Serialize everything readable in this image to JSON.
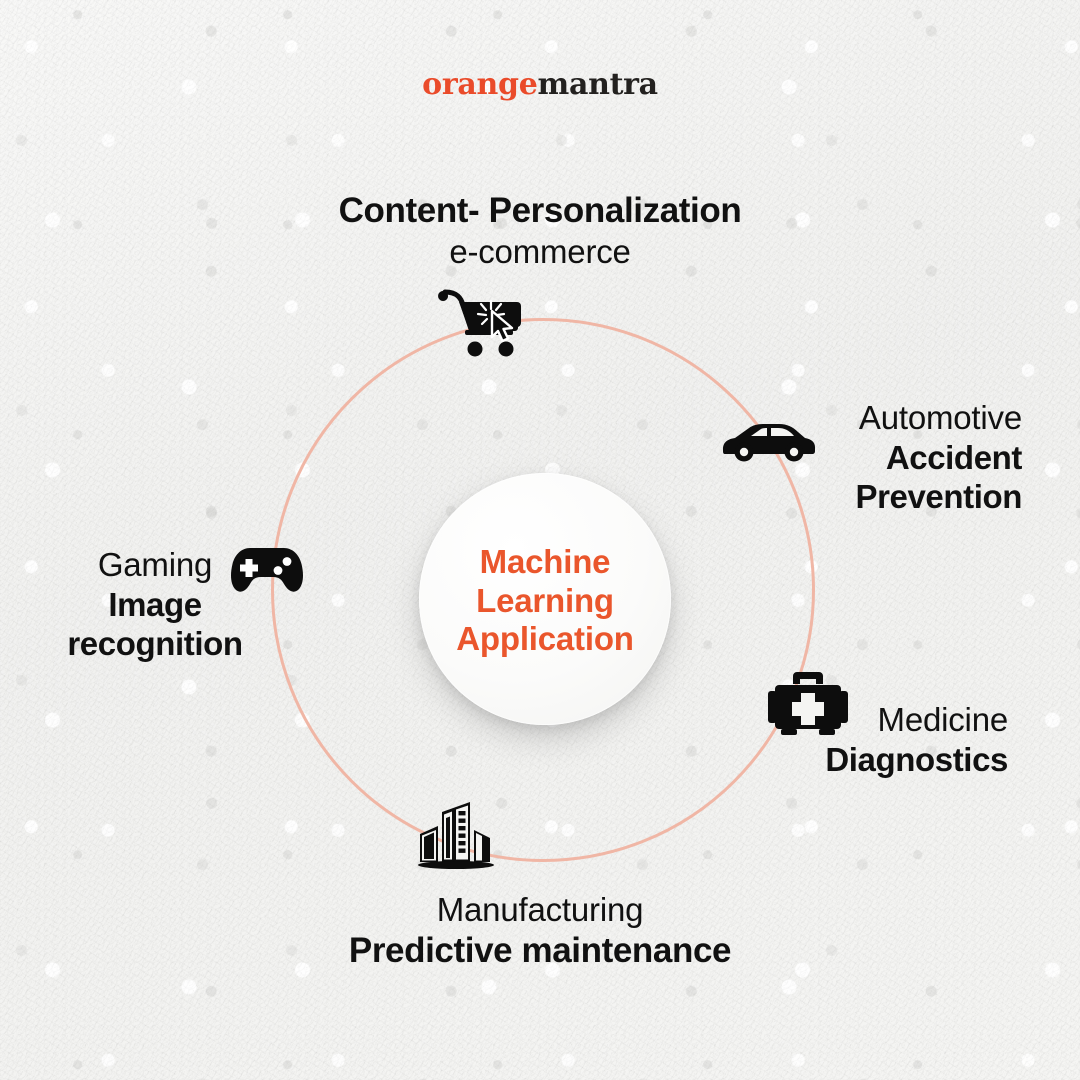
{
  "brand": {
    "name_part_colored": "orange",
    "name_part_dark": "mantra",
    "colored_hex": "#EA4B2A",
    "dark_hex": "#23211F"
  },
  "center": {
    "label": "Machine\nLearning\nApplication",
    "text_color": "#EA562C"
  },
  "ring": {
    "color": "#F0B6A5"
  },
  "nodes": [
    {
      "id": "ecommerce",
      "icon": "shopping-cart-click-icon",
      "line_bold": "Content- Personalization",
      "line_regular": "e-commerce"
    },
    {
      "id": "automotive",
      "icon": "car-icon",
      "line_regular": "Automotive",
      "line_bold_1": "Accident",
      "line_bold_2": "Prevention"
    },
    {
      "id": "medicine",
      "icon": "medical-kit-icon",
      "line_regular": "Medicine",
      "line_bold": "Diagnostics"
    },
    {
      "id": "manufacturing",
      "icon": "buildings-icon",
      "line_regular": "Manufacturing",
      "line_bold": "Predictive maintenance"
    },
    {
      "id": "gaming",
      "icon": "gamepad-icon",
      "line_regular": "Gaming",
      "line_bold_1": "Image",
      "line_bold_2": "recognition"
    }
  ]
}
